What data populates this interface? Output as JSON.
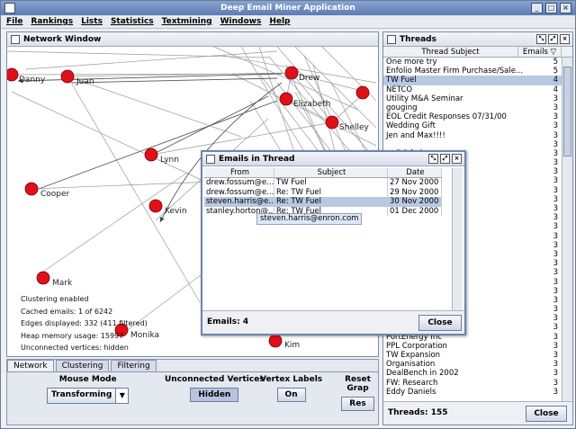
{
  "app": {
    "title": "Deep Email Miner Application"
  },
  "menu": [
    "File",
    "Rankings",
    "Lists",
    "Statistics",
    "Textmining",
    "Windows",
    "Help"
  ],
  "network_window": {
    "title": "Network Window",
    "nodes": [
      {
        "label": "Danny"
      },
      {
        "label": "Juan"
      },
      {
        "label": "Drew"
      },
      {
        "label": "Elizabeth"
      },
      {
        "label": "Shelley"
      },
      {
        "label": "Lynn"
      },
      {
        "label": "Cooper"
      },
      {
        "label": "Kevin"
      },
      {
        "label": "Mark"
      },
      {
        "label": "Monika"
      },
      {
        "label": "Kim"
      }
    ],
    "stats": [
      "Clustering enabled",
      "Cached emails: 1 of 6242",
      "Edges displayed: 332 (411 filtered)",
      "Heap memory usage: 15997",
      "Unconnected vertices: hidden"
    ]
  },
  "control_panel": {
    "tabs": [
      "Network",
      "Clustering",
      "Filtering"
    ],
    "mouse_mode": {
      "label": "Mouse Mode",
      "value": "Transforming"
    },
    "unconnected": {
      "label": "Unconnected Vertices",
      "button": "Hidden"
    },
    "vertex_labels": {
      "label": "Vertex Labels",
      "button": "On"
    },
    "reset": {
      "label": "Reset Grap",
      "button": "Res"
    }
  },
  "threads": {
    "title": "Threads",
    "col_subject": "Thread Subject",
    "col_emails": "Emails ▽",
    "rows": [
      {
        "subject": "One more try",
        "count": "5"
      },
      {
        "subject": "Enfolio Master Firm Purchase/Sale...",
        "count": "5"
      },
      {
        "subject": "TW Fuel",
        "count": "4"
      },
      {
        "subject": "NETCO",
        "count": "4"
      },
      {
        "subject": "Utility M&A Seminar",
        "count": "3"
      },
      {
        "subject": "gouging",
        "count": "3"
      },
      {
        "subject": "EOL Credit Responses 07/31/00",
        "count": "3"
      },
      {
        "subject": "Wedding Gift",
        "count": "3"
      },
      {
        "subject": "Jen and Max!!!!",
        "count": "3"
      },
      {
        "subject": "",
        "count": "3"
      },
      {
        "subject": "at DC feder...",
        "count": "3"
      },
      {
        "subject": "ompany",
        "count": "3"
      },
      {
        "subject": "",
        "count": "3"
      },
      {
        "subject": "sting",
        "count": "3"
      },
      {
        "subject": "",
        "count": "3"
      },
      {
        "subject": "as Company",
        "count": "3"
      },
      {
        "subject": "anning",
        "count": "3"
      },
      {
        "subject": "",
        "count": "3"
      },
      {
        "subject": "",
        "count": "3"
      },
      {
        "subject": "",
        "count": "3"
      },
      {
        "subject": "",
        "count": "3"
      },
      {
        "subject": "",
        "count": "3"
      },
      {
        "subject": "",
        "count": "3"
      },
      {
        "subject": "",
        "count": "3"
      },
      {
        "subject": "",
        "count": "3"
      },
      {
        "subject": "al",
        "count": "3"
      },
      {
        "subject": "",
        "count": "3"
      },
      {
        "subject": "",
        "count": "3"
      },
      {
        "subject": "",
        "count": "3"
      },
      {
        "subject": "",
        "count": "3"
      },
      {
        "subject": "PortEnergy Inc",
        "count": "3"
      },
      {
        "subject": "PPL Corporation",
        "count": "3"
      },
      {
        "subject": "TW Expansion",
        "count": "3"
      },
      {
        "subject": "Organisation",
        "count": "3"
      },
      {
        "subject": "DealBench in 2002",
        "count": "3"
      },
      {
        "subject": "FW: Research",
        "count": "3"
      },
      {
        "subject": "Eddy Daniels",
        "count": "3"
      }
    ],
    "footer": "Threads: 155",
    "close": "Close"
  },
  "dialog": {
    "title": "Emails in Thread",
    "col_from": "From",
    "col_subject": "Subject",
    "col_date": "Date",
    "rows": [
      {
        "from": "drew.fossum@e...",
        "subject": "TW Fuel",
        "date": "27 Nov 2000"
      },
      {
        "from": "drew.fossum@e...",
        "subject": "Re: TW Fuel",
        "date": "29 Nov 2000"
      },
      {
        "from": "steven.harris@e...",
        "subject": "Re: TW Fuel",
        "date": "30 Nov 2000"
      },
      {
        "from": "stanley.horton@...",
        "subject": "Re: TW Fuel",
        "date": "01 Dec 2000"
      }
    ],
    "tooltip": "steven.harris@enron.com",
    "footer": "Emails: 4",
    "close": "Close"
  },
  "colors": {
    "node": "#e0101a",
    "selection": "#b8c8e2",
    "titlebar": "#5c7bb4"
  }
}
